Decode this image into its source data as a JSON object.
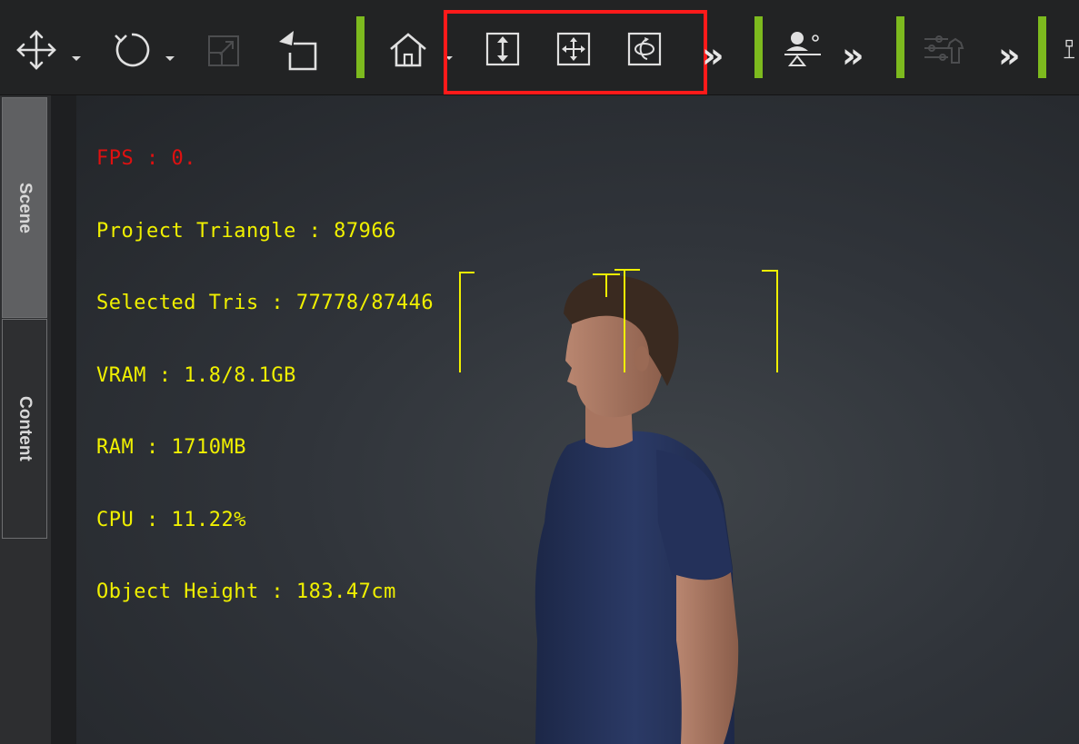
{
  "toolbar": {
    "icons": [
      "move-icon",
      "rotate-icon",
      "scale-icon",
      "pick-parent-icon",
      "home-camera-icon",
      "fit-height-icon",
      "pan-icon",
      "orbit-icon",
      "character-icon",
      "morph-slider-icon",
      "more-icon"
    ],
    "more_chevron": "»",
    "accent_color": "#7dba1e",
    "highlight_color": "#ff1a1a"
  },
  "side_tabs": [
    {
      "label": "Scene"
    },
    {
      "label": "Content"
    }
  ],
  "stats": {
    "fps": "FPS : 0.",
    "project_triangle": "Project Triangle : 87966",
    "selected_tris": "Selected Tris : 77778/87446",
    "vram": "VRAM : 1.8/8.1GB",
    "ram": "RAM : 1710MB",
    "cpu": "CPU : 11.22%",
    "object_height": "Object Height : 183.47cm"
  }
}
